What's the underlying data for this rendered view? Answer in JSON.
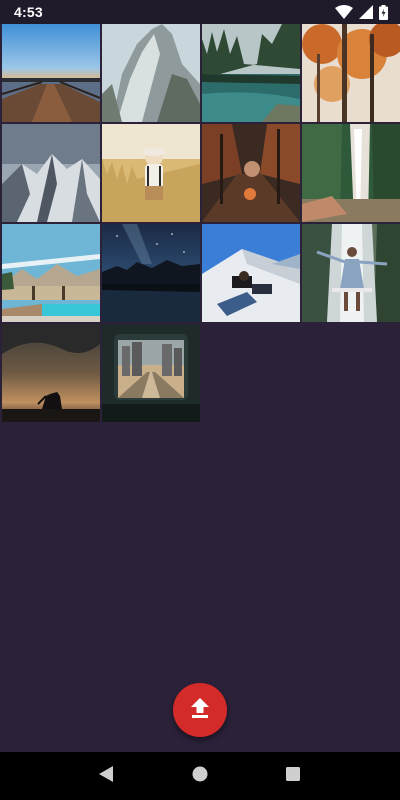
{
  "status_bar": {
    "time": "4:53",
    "icons": [
      "wifi-icon",
      "signal-icon",
      "battery-icon"
    ]
  },
  "gallery": {
    "photos": [
      {
        "name": "pier-sunset"
      },
      {
        "name": "rocky-mountain-cliff"
      },
      {
        "name": "forest-lake"
      },
      {
        "name": "autumn-trees"
      },
      {
        "name": "snowy-mountains"
      },
      {
        "name": "child-wheat-field"
      },
      {
        "name": "autumn-forest-path"
      },
      {
        "name": "waterfall-cliff"
      },
      {
        "name": "pool-mountains"
      },
      {
        "name": "night-sky-lake"
      },
      {
        "name": "person-building-sky"
      },
      {
        "name": "woman-waterfall"
      },
      {
        "name": "storm-clouds-silhouette"
      },
      {
        "name": "train-window-city"
      }
    ]
  },
  "fab": {
    "icon": "upload-icon",
    "color": "#d32a2a"
  },
  "navigation": {
    "icons": [
      "back-icon",
      "home-icon",
      "recents-icon"
    ]
  },
  "colors": {
    "background": "#2b2139",
    "status_bar": "#201a2b",
    "accent": "#d32a2a"
  }
}
